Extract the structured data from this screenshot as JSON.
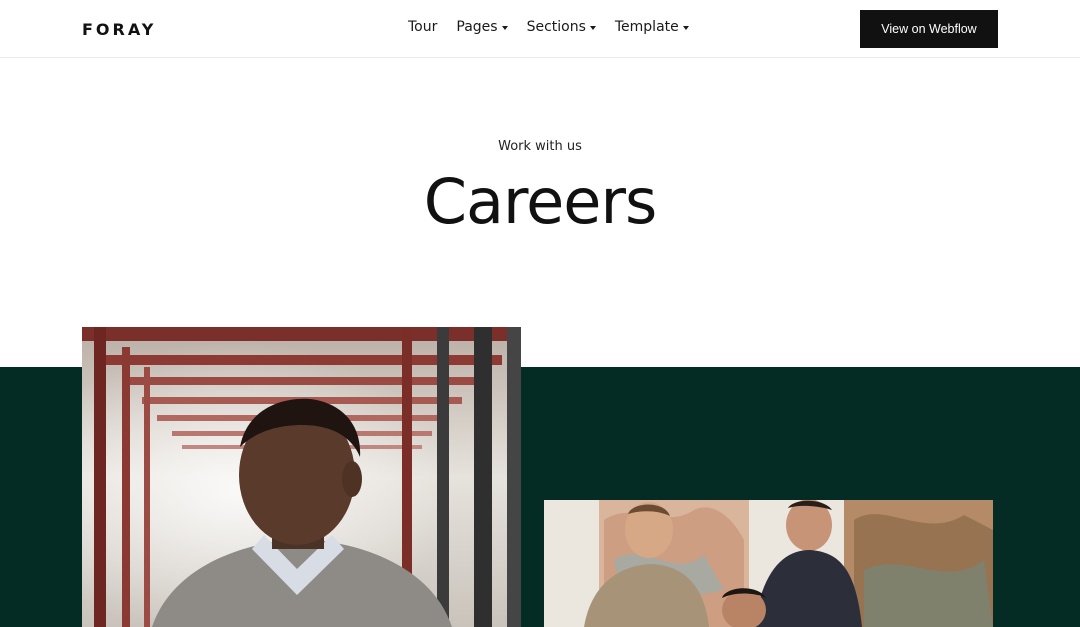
{
  "header": {
    "logo": "FORAY",
    "nav": [
      {
        "label": "Tour",
        "has_dropdown": false
      },
      {
        "label": "Pages",
        "has_dropdown": true
      },
      {
        "label": "Sections",
        "has_dropdown": true
      },
      {
        "label": "Template",
        "has_dropdown": true
      }
    ],
    "cta_label": "View on Webflow"
  },
  "hero": {
    "eyebrow": "Work with us",
    "title": "Careers"
  },
  "colors": {
    "band": "#042b24",
    "cta_bg": "#111111",
    "text": "#111111"
  }
}
